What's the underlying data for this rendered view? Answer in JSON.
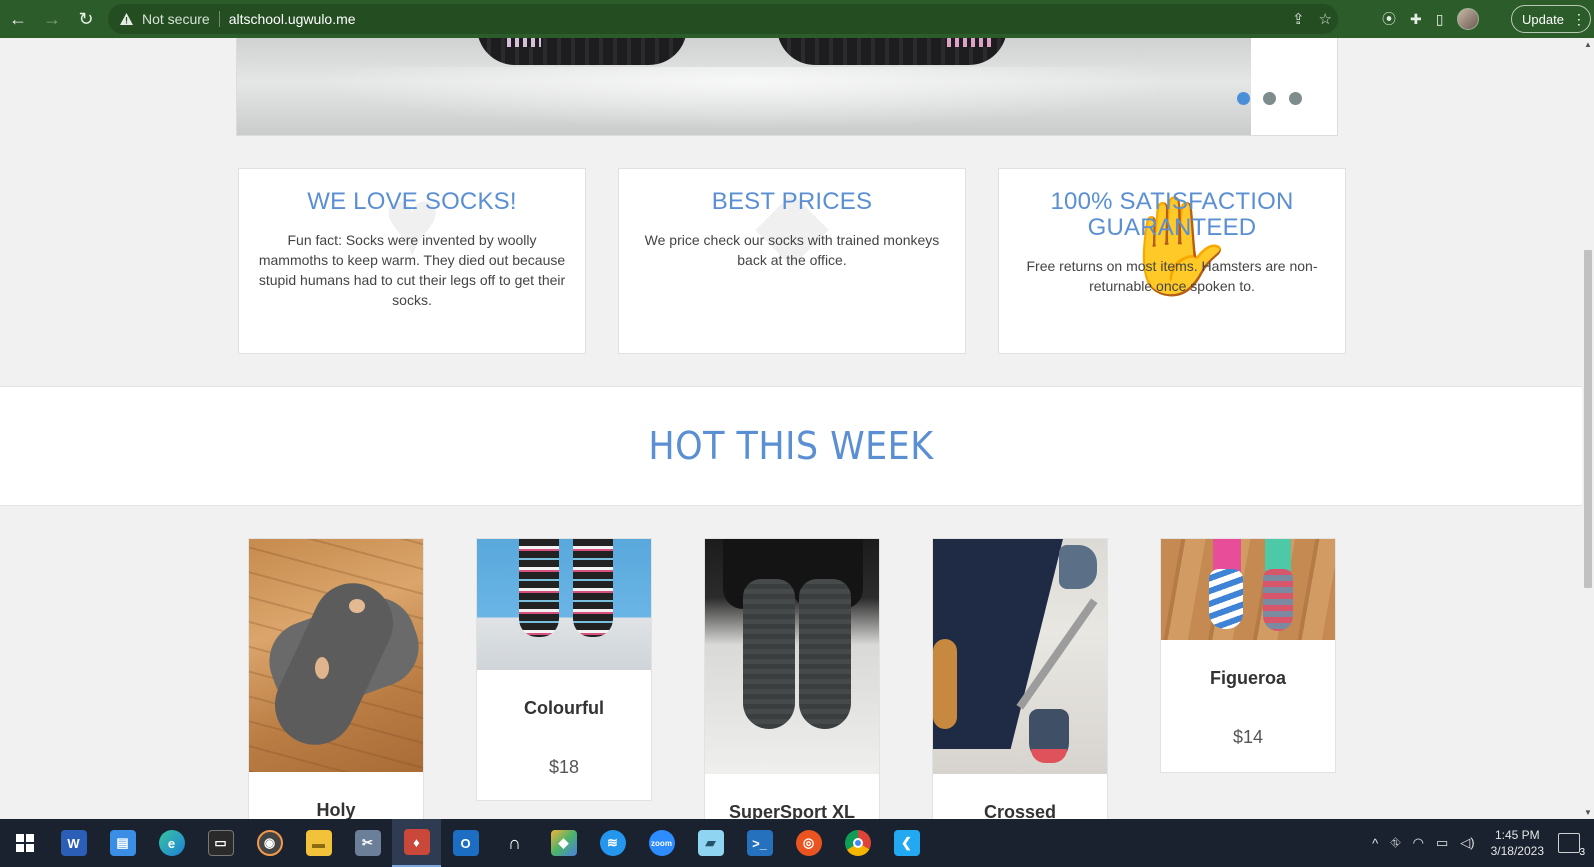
{
  "browser": {
    "security_label": "Not secure",
    "url": "altschool.ugwulo.me",
    "update_label": "Update"
  },
  "carousel": {
    "slide_count": 3,
    "active_slide": 1
  },
  "features": [
    {
      "title": "WE LOVE SOCKS!",
      "text": "Fun fact: Socks were invented by woolly mammoths to keep warm. They died out because stupid humans had to cut their legs off to get their socks."
    },
    {
      "title": "BEST PRICES",
      "text": "We price check our socks with trained monkeys back at the office."
    },
    {
      "title": "100% SATISFACTION GUARANTEED",
      "text": "Free returns on most items. Hamsters are non-returnable once spoken to."
    }
  ],
  "hot_section": {
    "title": "HOT THIS WEEK"
  },
  "products": [
    {
      "name": "Holy"
    },
    {
      "name": "Colourful",
      "price": "$18"
    },
    {
      "name": "SuperSport XL"
    },
    {
      "name": "Crossed"
    },
    {
      "name": "Figueroa",
      "price": "$14"
    }
  ],
  "taskbar": {
    "apps": [
      "start",
      "word",
      "file-manager",
      "edge",
      "terminal",
      "media",
      "explorer",
      "snipping",
      "git-client",
      "outlook",
      "headset",
      "git",
      "docker",
      "zoom",
      "notepad",
      "powershell",
      "ubuntu",
      "chrome",
      "vscode"
    ],
    "time": "1:45 PM",
    "date": "3/18/2023",
    "notifications": "3"
  },
  "colors": {
    "accent": "#5b8fd3",
    "chrome": "#2c5c2a",
    "taskbar": "#1a2230"
  }
}
